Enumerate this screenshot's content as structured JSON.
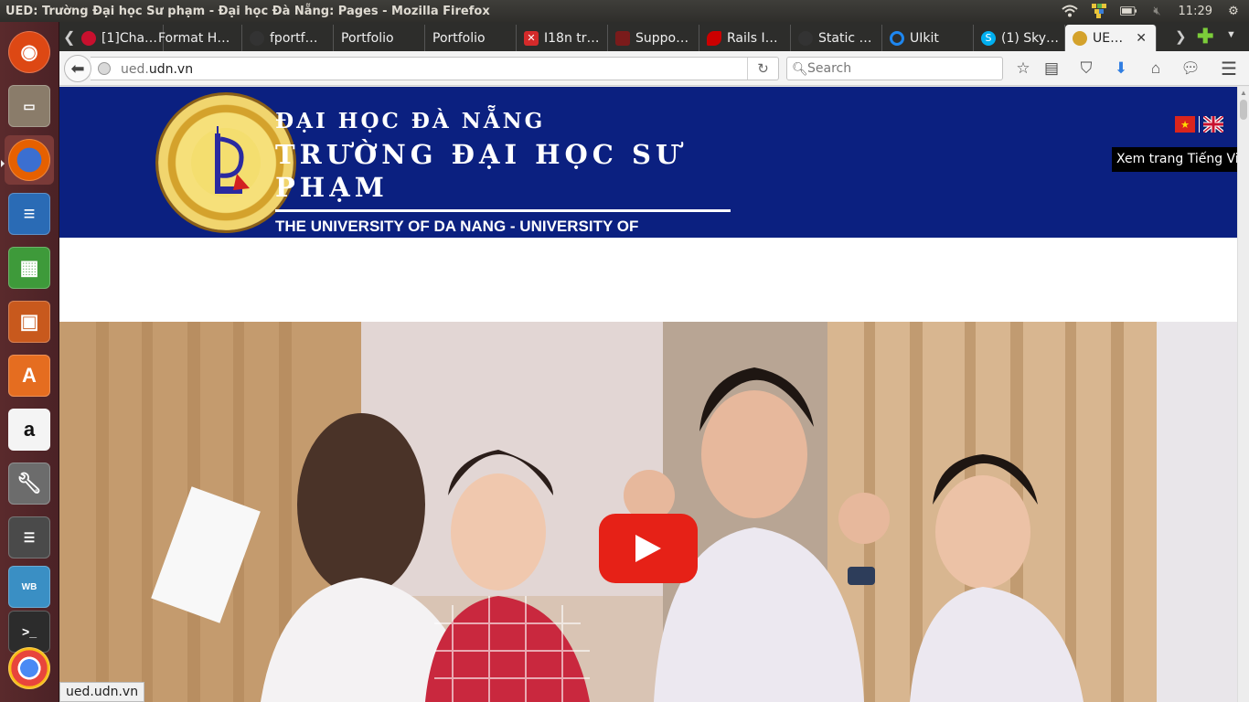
{
  "top_panel": {
    "window_title": "UED: Trường Đại học Sư phạm - Đại học Đà Nẵng: Pages - Mozilla Firefox",
    "clock": "11:29",
    "icons": [
      "wifi-icon",
      "keyboard-layout-icon",
      "battery-icon",
      "volume-muted-icon",
      "settings-gear-icon"
    ]
  },
  "launcher": {
    "apps": [
      "ubuntu-dash",
      "files",
      "firefox",
      "libreoffice-writer",
      "libreoffice-calc",
      "libreoffice-impress",
      "ubuntu-software-center",
      "amazon",
      "system-settings",
      "workspace-switcher",
      "mysql-workbench",
      "terminal-stack",
      "chrome",
      "more"
    ]
  },
  "tabs": [
    {
      "label": "[1]Cha…",
      "icon": "reddit-icon",
      "color": "#c8102e"
    },
    {
      "label": "Format H…",
      "icon": "none",
      "color": ""
    },
    {
      "label": "fportf…",
      "icon": "github-icon",
      "color": "#333333"
    },
    {
      "label": "Portfolio",
      "icon": "none",
      "color": ""
    },
    {
      "label": "Portfolio",
      "icon": "none",
      "color": ""
    },
    {
      "label": "I18n tr…",
      "icon": "x-red-icon",
      "color": "#d42a2a"
    },
    {
      "label": "Suppo…",
      "icon": "zendesk-icon",
      "color": "#7a1b1b"
    },
    {
      "label": "Rails I…",
      "icon": "rails-icon",
      "color": "#cc0000"
    },
    {
      "label": "Static …",
      "icon": "github-icon",
      "color": "#333333"
    },
    {
      "label": "UIkit",
      "icon": "uikit-icon",
      "color": "#1e87f0"
    },
    {
      "label": "(1) Sky…",
      "icon": "skype-icon",
      "color": "#00aff0"
    },
    {
      "label": "UE…",
      "icon": "ued-icon",
      "color": "#d4a22c"
    }
  ],
  "active_tab_index": 11,
  "nav": {
    "url_prefix": "ued.",
    "url_host": "udn.vn",
    "search_placeholder": "Search"
  },
  "page": {
    "header_line1": "ĐẠI HỌC ĐÀ NẴNG",
    "header_line2": "TRƯỜNG ĐẠI HỌC SƯ PHẠM",
    "header_line3": "THE UNIVERSITY OF DA NANG - UNIVERSITY OF",
    "tooltip": "Xem trang Tiếng Việt",
    "header_bg": "#0b2080",
    "video_button_color": "#e62117"
  },
  "status_bar": {
    "url": "ued.udn.vn"
  }
}
